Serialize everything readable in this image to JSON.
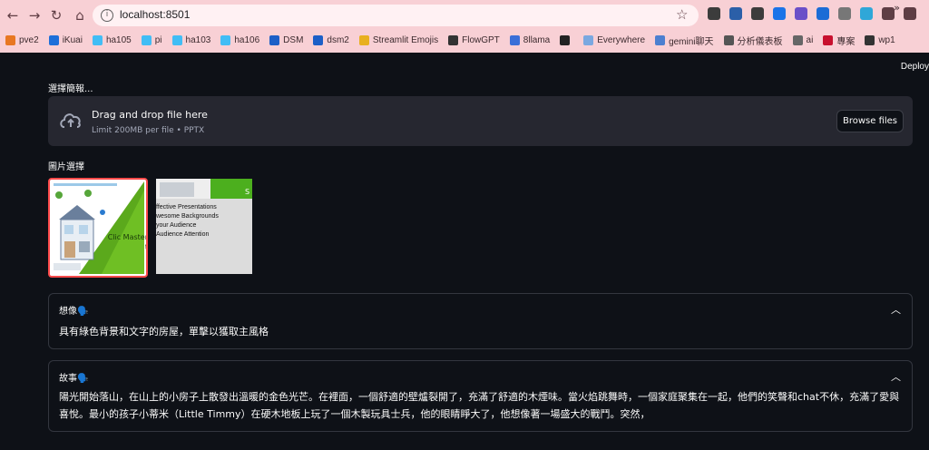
{
  "browser": {
    "url": "localhost:8501",
    "bookmarks": [
      {
        "label": "pve2",
        "color": "#e87722"
      },
      {
        "label": "iKuai",
        "color": "#1e6fd9"
      },
      {
        "label": "ha105",
        "color": "#41bdf5"
      },
      {
        "label": "pi",
        "color": "#41bdf5"
      },
      {
        "label": "ha103",
        "color": "#41bdf5"
      },
      {
        "label": "ha106",
        "color": "#41bdf5"
      },
      {
        "label": "DSM",
        "color": "#1c5fc7"
      },
      {
        "label": "dsm2",
        "color": "#1c5fc7"
      },
      {
        "label": "Streamlit Emojis",
        "color": "#e8b020"
      },
      {
        "label": "FlowGPT",
        "color": "#333333"
      },
      {
        "label": "8llama",
        "color": "#3a6fd8"
      },
      {
        "label": "",
        "color": "#222222"
      },
      {
        "label": "Everywhere",
        "color": "#7aa8e0"
      },
      {
        "label": "gemini聊天",
        "color": "#4c7fd0"
      },
      {
        "label": "分析儀表板",
        "color": "#555555"
      },
      {
        "label": "ai",
        "color": "#666666"
      },
      {
        "label": "專案",
        "color": "#c8102e"
      },
      {
        "label": "wp1",
        "color": "#333333"
      }
    ],
    "more": "»"
  },
  "app": {
    "deploy_label": "Deploy",
    "upload_label": "選擇簡報...",
    "uploader": {
      "title": "Drag and drop file here",
      "limit": "Limit 200MB per file • PPTX",
      "button": "Browse files"
    },
    "image_select_label": "圖片選擇",
    "thumbs": {
      "first": {
        "text": "Clic Master t"
      },
      "second": {
        "header": "S",
        "lines": [
          "ffective Presentations",
          "wesome Backgrounds",
          "your Audience",
          "Audience Attention"
        ]
      }
    },
    "expanders": [
      {
        "title": "想像🗣️",
        "body": "具有綠色背景和文字的房屋，單擊以獲取主風格"
      },
      {
        "title": "故事🗣️",
        "body": "陽光開始落山，在山上的小房子上散發出溫暖的金色光芒。在裡面，一個舒適的壁爐裂開了，充滿了舒適的木煙味。當火焰跳舞時，一個家庭聚集在一起，他們的笑聲和chat不休，充滿了愛與喜悅。最小的孩子小蒂米（Little Timmy）在硬木地板上玩了一個木製玩具士兵，他的眼睛睜大了，他想像著一場盛大的戰鬥。突然，"
      }
    ]
  }
}
